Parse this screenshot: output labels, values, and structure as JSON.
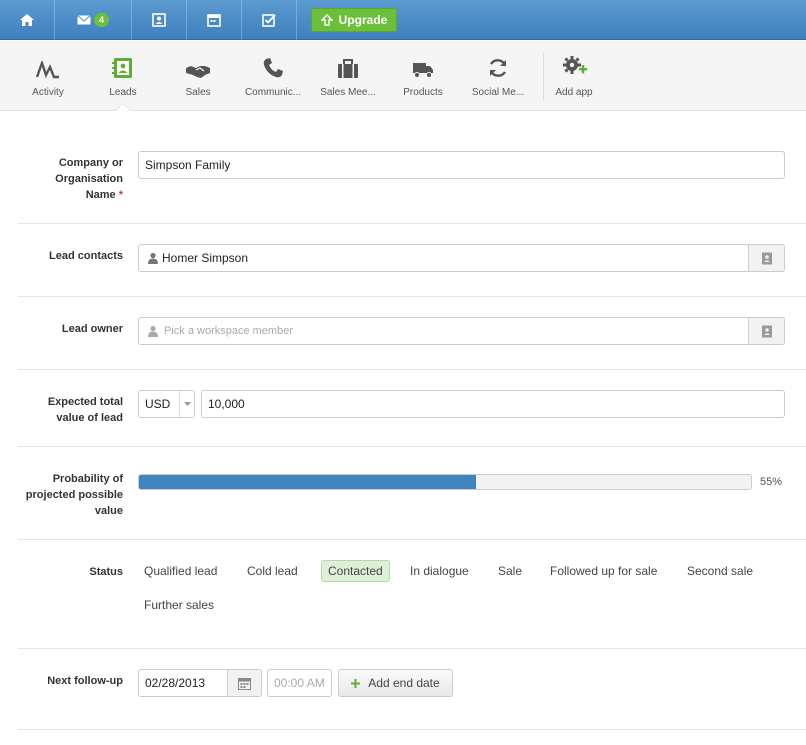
{
  "topbar": {
    "mail_badge": "4",
    "upgrade_label": "Upgrade",
    "colors": {
      "bar": "#4a8cc8",
      "upgrade": "#6cbf3b",
      "badge": "#6fbe3c"
    }
  },
  "apps": [
    {
      "label": "Activity",
      "icon": "activity-icon"
    },
    {
      "label": "Leads",
      "icon": "leads-icon",
      "active": true
    },
    {
      "label": "Sales",
      "icon": "handshake-icon"
    },
    {
      "label": "Communic...",
      "icon": "phone-icon"
    },
    {
      "label": "Sales Mee...",
      "icon": "briefcase-icon"
    },
    {
      "label": "Products",
      "icon": "truck-icon"
    },
    {
      "label": "Social Me...",
      "icon": "refresh-icon"
    },
    {
      "label": "Add app",
      "icon": "gear-plus-icon"
    }
  ],
  "form": {
    "company": {
      "label_line1": "Company or",
      "label_line2": "Organisation",
      "label_line3": "Name",
      "required_mark": "*",
      "value": "Simpson Family"
    },
    "contacts": {
      "label": "Lead contacts",
      "value": "Homer Simpson"
    },
    "owner": {
      "label": "Lead owner",
      "placeholder": "Pick a workspace member"
    },
    "value": {
      "label_line1": "Expected total",
      "label_line2": "value of lead",
      "currency": "USD",
      "amount": "10,000"
    },
    "probability": {
      "label_line1": "Probability of",
      "label_line2": "projected possible",
      "label_line3": "value",
      "percent": 55,
      "percent_text": "55%"
    },
    "status": {
      "label": "Status",
      "options": [
        "Qualified lead",
        "Cold lead",
        "Contacted",
        "In dialogue",
        "Sale",
        "Followed up for sale",
        "Second sale",
        "Further sales"
      ],
      "selected": "Contacted"
    },
    "followup": {
      "label": "Next follow-up",
      "date": "02/28/2013",
      "time_placeholder": "00:00 AM",
      "add_end_label": "Add end date"
    }
  }
}
